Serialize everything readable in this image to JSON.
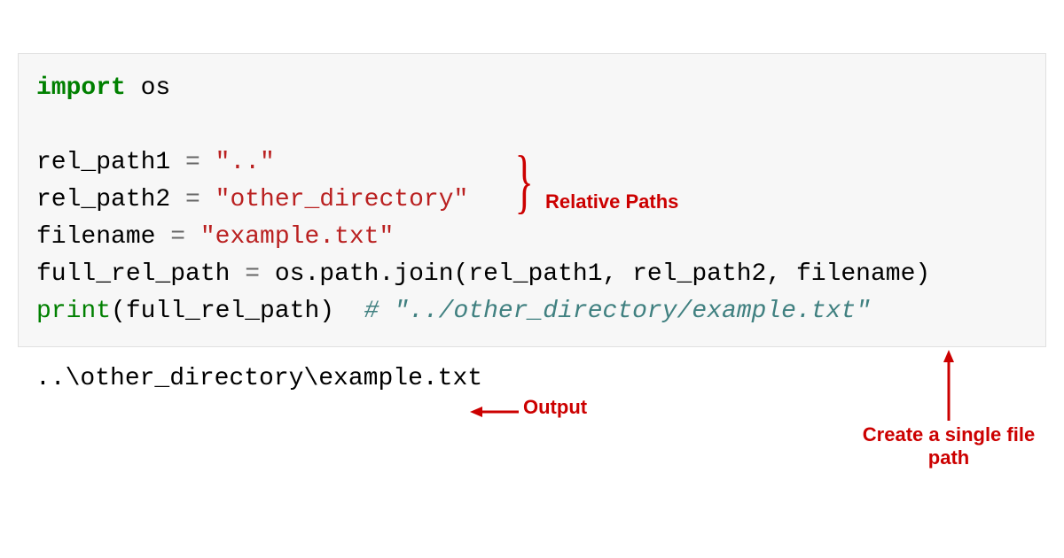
{
  "code": {
    "line1_kw": "import",
    "line1_mod": " os",
    "line3_var": "rel_path1 ",
    "line3_op": "=",
    "line3_str": " \"..\"",
    "line4_var": "rel_path2 ",
    "line4_op": "=",
    "line4_str": " \"other_directory\"",
    "line5_var": "filename ",
    "line5_op": "=",
    "line5_str": " \"example.txt\"",
    "line6_var": "full_rel_path ",
    "line6_op": "=",
    "line6_call": " os.path.join(rel_path1, rel_path2, filename)",
    "line7_fn": "print",
    "line7_args": "(full_rel_path)  ",
    "line7_comment": "# \"../other_directory/example.txt\""
  },
  "output": "..\\other_directory\\example.txt",
  "annotations": {
    "relative_paths": "Relative Paths",
    "output_label": "Output",
    "single_file_path": "Create a single file\npath"
  },
  "colors": {
    "keyword": "#008000",
    "string": "#ba2121",
    "comment": "#408080",
    "annotation": "#cc0000",
    "code_bg": "#f7f7f7"
  }
}
